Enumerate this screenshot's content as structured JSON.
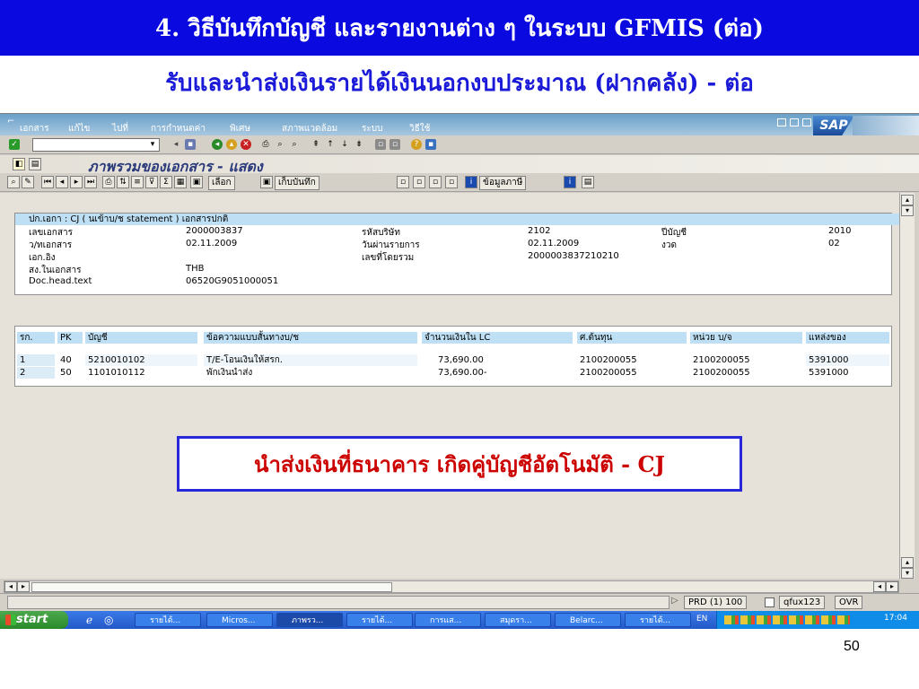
{
  "slide": {
    "title": "4. วิธีบันทึกบัญชี และรายงานต่าง ๆ ในระบบ GFMIS (ต่อ)",
    "subtitle": "รับและนำส่งเงินรายได้เงินนอกงบประมาณ (ฝากคลัง) - ต่อ",
    "page_number": "50"
  },
  "menubar": {
    "items": [
      "เอกสาร",
      "แก้ไข",
      "ไปที่",
      "การกำหนดค่า",
      "พิเศษ",
      "สภาพแวดล้อม",
      "ระบบ",
      "วิธีใช้"
    ],
    "logo": "SAP"
  },
  "screen_title": "ภาพรวมของเอกสาร - แสดง",
  "toolbar2": {
    "select_label": "เลือก",
    "save_label": "เก็บบันทึก",
    "tax_label": "ข้อมูลภาษี"
  },
  "doc_header": {
    "title": "ปก.เอกา : CJ ( นเข้าบ/ช statement ) เอกสารปกติ",
    "fields": [
      {
        "label": "เลขเอกสาร",
        "value": "2000003837"
      },
      {
        "label": "ว/ทเอกสาร",
        "value": "02.11.2009"
      },
      {
        "label": "เอก.อิง",
        "value": ""
      },
      {
        "label": "สง.ในเอกสาร",
        "value": "THB"
      },
      {
        "label": "Doc.head.text",
        "value": "06520G9051000051"
      }
    ],
    "fields_mid": [
      {
        "label": "รหัสบริษัท",
        "value": "2102"
      },
      {
        "label": "วันผ่านรายการ",
        "value": "02.11.2009"
      },
      {
        "label": "เลขที่โดยรวม",
        "value": "2000003837210210"
      }
    ],
    "fields_right": [
      {
        "label": "ปีบัญชี",
        "value": "2010"
      },
      {
        "label": "งวด",
        "value": "02"
      }
    ]
  },
  "line_items": {
    "columns": [
      "รก.",
      "PK",
      "บัญชี",
      "ข้อความแบบสั้นทางบ/ช",
      "จำนวนเงินใน LC",
      "ศ.ต้นทุน",
      "หน่วย บ/จ",
      "แหล่งของ"
    ],
    "rows": [
      [
        "1",
        "40",
        "5210010102",
        "T/E-โอนเงินให้สรก.",
        "73,690.00",
        "2100200055",
        "2100200055",
        "5391000"
      ],
      [
        "2",
        "50",
        "1101010112",
        "พักเงินนำส่ง",
        "73,690.00-",
        "2100200055",
        "2100200055",
        "5391000"
      ]
    ]
  },
  "callout": "นำส่งเงินที่ธนาคาร เกิดคู่บัญชีอัตโนมัติ - CJ",
  "status": {
    "system": "PRD (1) 100",
    "user": "qfux123",
    "mode": "OVR"
  },
  "taskbar": {
    "start": "start",
    "tasks": [
      "รายได้...",
      "Micros...",
      "ภาพรว...",
      "รายได้...",
      "การแส...",
      "สมุดรา...",
      "Belarc...",
      "รายได้..."
    ],
    "lang": "EN",
    "clock": "17:04"
  }
}
